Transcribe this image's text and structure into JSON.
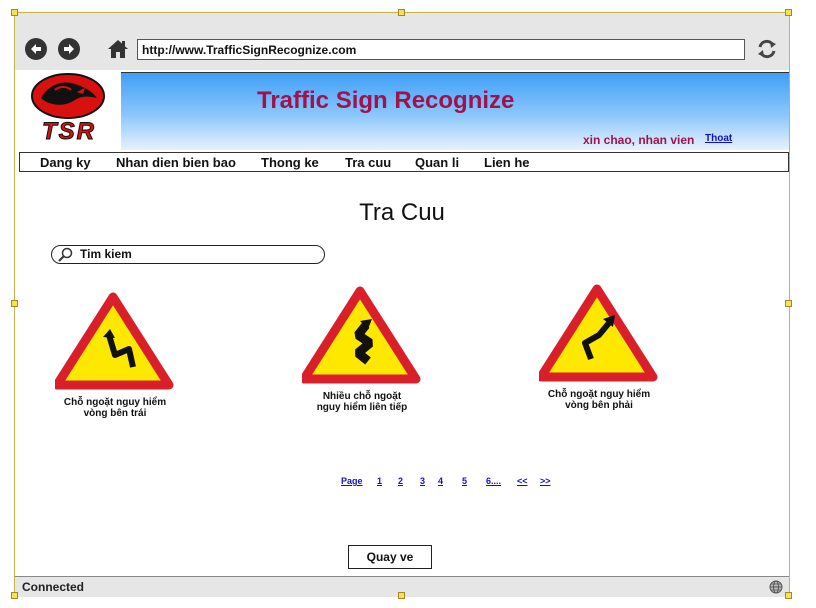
{
  "browser": {
    "url": "http://www.TrafficSignRecognize.com",
    "status": "Connected"
  },
  "logo": {
    "text": "TSR"
  },
  "header": {
    "title": "Traffic Sign Recognize",
    "greeting": "xin chao, nhan vien",
    "logout": "Thoat"
  },
  "menu": [
    "Dang ky",
    "Nhan dien bien bao",
    "Thong ke",
    "Tra cuu",
    "Quan li",
    "Lien he"
  ],
  "main": {
    "heading": "Tra Cuu",
    "search_placeholder": "Tim kiem",
    "signs": [
      {
        "line1": "Chỗ ngoặt nguy hiểm",
        "line2": "vòng bên trái"
      },
      {
        "line1": "Nhiều chỗ ngoặt",
        "line2": "nguy hiểm liên tiếp"
      },
      {
        "line1": "Chỗ ngoặt nguy hiểm",
        "line2": "vòng bên phải"
      }
    ],
    "pagination": [
      "Page",
      "1",
      "2",
      "3",
      "4",
      "5",
      "6....",
      "<<",
      ">>"
    ],
    "back_button": "Quay ve"
  },
  "colors": {
    "title": "#a0124e",
    "link": "#1010cc",
    "sign_border": "#d9202a",
    "sign_fill": "#ffe800"
  },
  "icons": [
    "back-arrow-icon",
    "forward-arrow-icon",
    "home-icon",
    "refresh-icon",
    "search-icon",
    "globe-icon"
  ]
}
